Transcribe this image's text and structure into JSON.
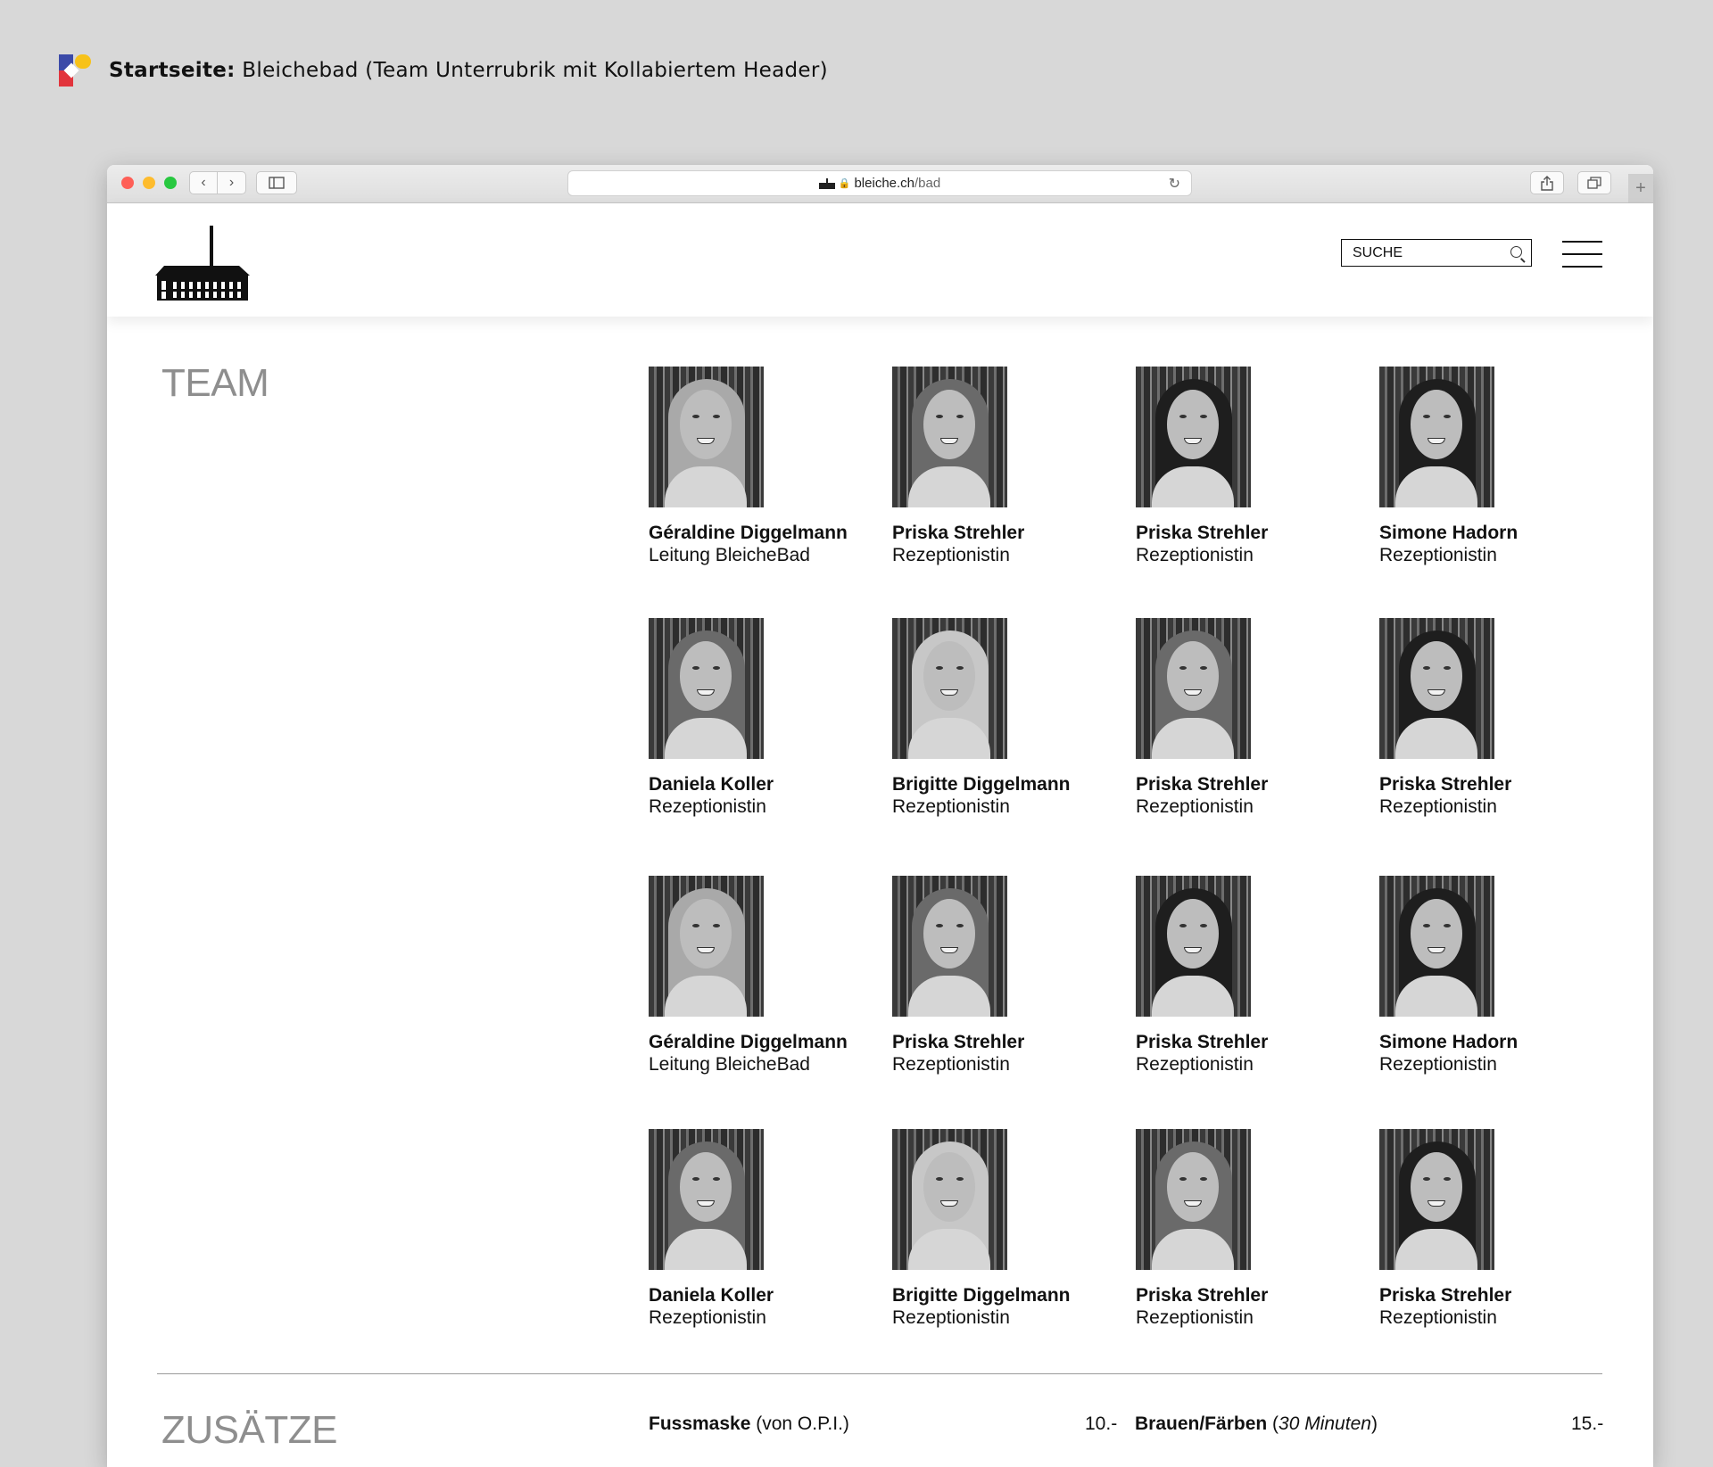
{
  "caption": {
    "bold": "Startseite:",
    "text": " Bleichebad (Team Unterrubrik mit Kollabiertem Header)"
  },
  "browser": {
    "url_domain": "bleiche.ch",
    "url_path": "/bad",
    "icons": [
      "back-arrow-icon",
      "forward-arrow-icon",
      "sidebar-icon",
      "lock-icon",
      "reload-icon",
      "share-icon",
      "tabs-icon",
      "plus-icon"
    ]
  },
  "header": {
    "search_placeholder": "SUCHE"
  },
  "team": {
    "title": "TEAM",
    "members": [
      {
        "name": "Géraldine Diggelmann",
        "role": "Leitung BleicheBad",
        "hair": "blonde"
      },
      {
        "name": "Priska Strehler",
        "role": "Rezeptionistin",
        "hair": "brown"
      },
      {
        "name": "Priska Strehler",
        "role": "Rezeptionistin",
        "hair": "dark"
      },
      {
        "name": "Simone Hadorn",
        "role": "Rezeptionistin",
        "hair": "dark"
      },
      {
        "name": "Daniela Koller",
        "role": "Rezeptionistin",
        "hair": "brown"
      },
      {
        "name": "Brigitte Diggelmann",
        "role": "Rezeptionistin",
        "hair": "grey"
      },
      {
        "name": "Priska Strehler",
        "role": "Rezeptionistin",
        "hair": "brown"
      },
      {
        "name": "Priska Strehler",
        "role": "Rezeptionistin",
        "hair": "dark"
      },
      {
        "name": "Géraldine Diggelmann",
        "role": "Leitung BleicheBad",
        "hair": "blonde"
      },
      {
        "name": "Priska Strehler",
        "role": "Rezeptionistin",
        "hair": "brown"
      },
      {
        "name": "Priska Strehler",
        "role": "Rezeptionistin",
        "hair": "dark"
      },
      {
        "name": "Simone Hadorn",
        "role": "Rezeptionistin",
        "hair": "dark"
      },
      {
        "name": "Daniela Koller",
        "role": "Rezeptionistin",
        "hair": "brown"
      },
      {
        "name": "Brigitte Diggelmann",
        "role": "Rezeptionistin",
        "hair": "grey"
      },
      {
        "name": "Priska Strehler",
        "role": "Rezeptionistin",
        "hair": "brown"
      },
      {
        "name": "Priska Strehler",
        "role": "Rezeptionistin",
        "hair": "dark"
      }
    ]
  },
  "extras": {
    "title": "ZUSÄTZE",
    "items": [
      {
        "name": "Fussmaske",
        "detail": " (von O.P.I.)",
        "price": "10.-"
      },
      {
        "name": "Brauen/Färben",
        "detail": "30 Minuten",
        "price": "15.-"
      }
    ]
  }
}
